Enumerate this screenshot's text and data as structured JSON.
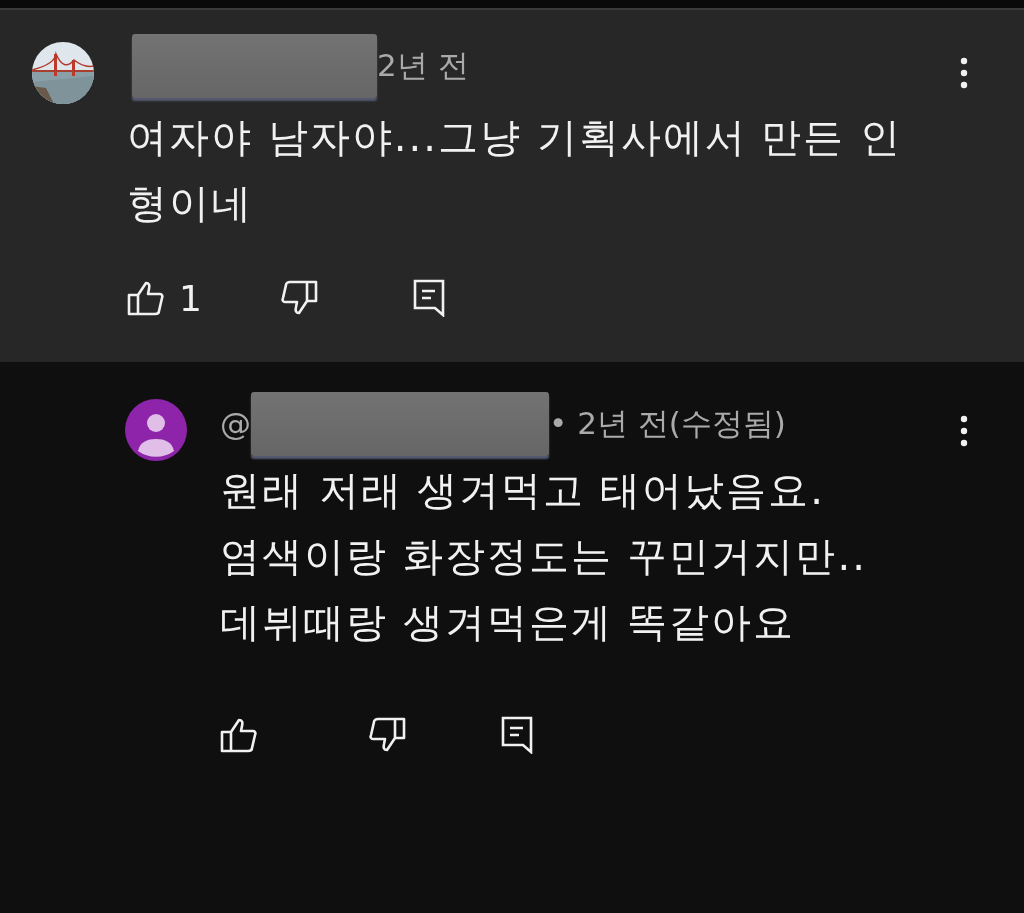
{
  "comments": [
    {
      "time": "2년 전",
      "text": "여자야 남자야...그냥 기획사에서 만든 인형이네",
      "likes": "1",
      "highlighted": true,
      "reply": false
    },
    {
      "avatar": {
        "kind": "default"
      },
      "handle_prefix": "@",
      "time": "• 2년 전(수정됨)",
      "text": "원래 저래 생겨먹고 태어났음요.\n염색이랑 화장정도는 꾸민거지만..\n데뷔때랑 생겨먹은게 똑같아요",
      "highlighted": false,
      "reply": true
    }
  ]
}
